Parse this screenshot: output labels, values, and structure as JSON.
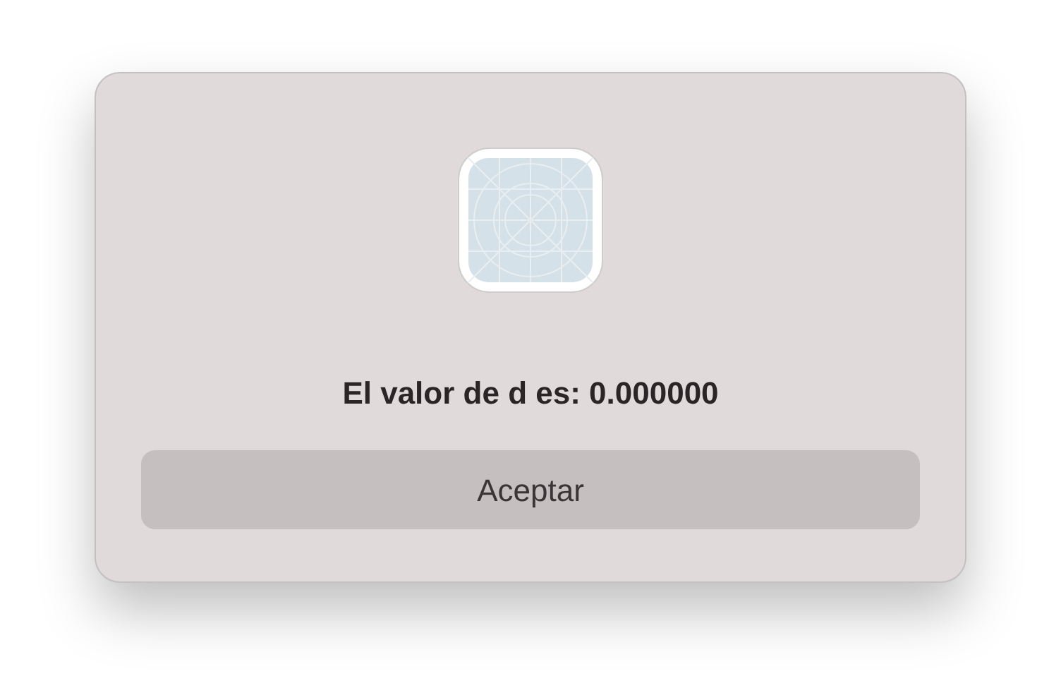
{
  "alert": {
    "message": "El valor de d es: 0.000000",
    "buttons": [
      {
        "label": "Aceptar",
        "selected": false
      }
    ]
  }
}
